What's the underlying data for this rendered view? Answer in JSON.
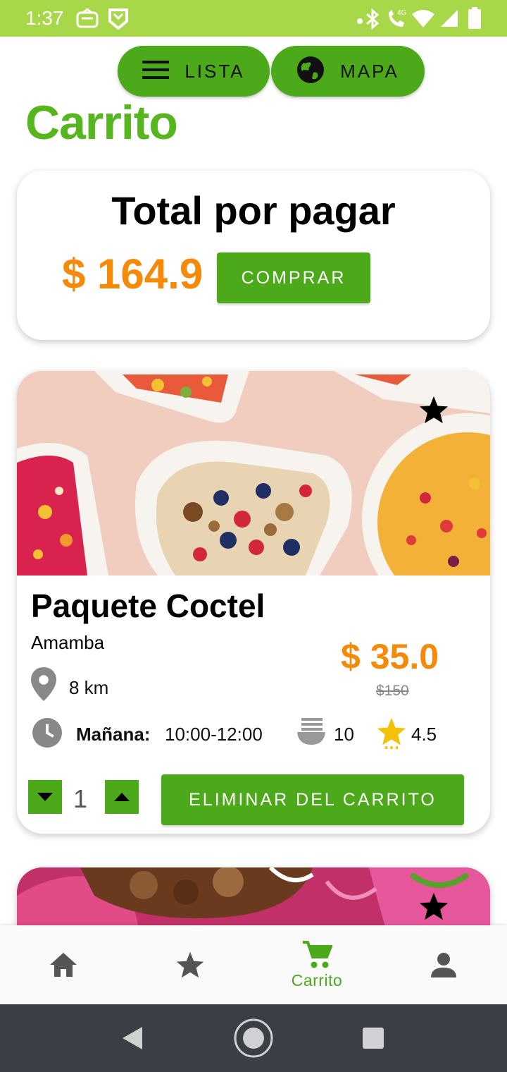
{
  "status_bar": {
    "time": "1:37",
    "network": "4G"
  },
  "top_toggle": {
    "list_label": "LISTA",
    "map_label": "MAPA"
  },
  "page_title": "Carrito",
  "total": {
    "title": "Total por pagar",
    "amount": "$ 164.9",
    "buy_label": "COMPRAR"
  },
  "product": {
    "name": "Paquete Coctel",
    "store": "Amamba",
    "distance": "8 km",
    "price": "$ 35.0",
    "old_price": "$150",
    "schedule_label": "Mañana:",
    "schedule_time": "10:00-12:00",
    "portions": "10",
    "rating": "4.5",
    "quantity": "1",
    "remove_label": "ELIMINAR DEL CARRITO"
  },
  "bottom_nav": {
    "active_label": "Carrito",
    "items": [
      "home-icon",
      "star-icon",
      "cart-icon",
      "person-icon"
    ]
  },
  "colors": {
    "brand_green": "#4caa1a",
    "title_green": "#57b61e",
    "status_bar": "#a8d84a",
    "price_orange": "#f48a07",
    "system_nav": "#3b3f45"
  }
}
